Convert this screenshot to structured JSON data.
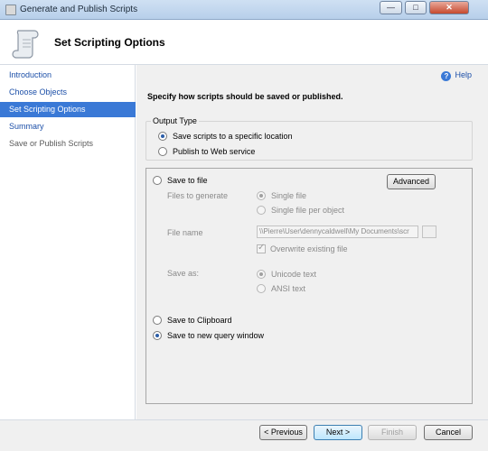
{
  "window": {
    "title": "Generate and Publish Scripts",
    "controls": {
      "minimize": "—",
      "maximize": "□",
      "close": "✕"
    }
  },
  "header": {
    "title": "Set Scripting Options"
  },
  "nav": {
    "items": [
      {
        "label": "Introduction",
        "state": "link"
      },
      {
        "label": "Choose Objects",
        "state": "link"
      },
      {
        "label": "Set Scripting Options",
        "state": "selected"
      },
      {
        "label": "Summary",
        "state": "link"
      },
      {
        "label": "Save or Publish Scripts",
        "state": "disabled"
      }
    ]
  },
  "main": {
    "help_label": "Help",
    "instruction": "Specify how scripts should be saved or published.",
    "output_type": {
      "title": "Output Type",
      "options": [
        {
          "label": "Save scripts to a specific location",
          "checked": true
        },
        {
          "label": "Publish to Web service",
          "checked": false
        }
      ]
    },
    "save_options": {
      "save_to_file": "Save to file",
      "advanced_button": "Advanced",
      "files_to_generate_label": "Files to generate",
      "single_file": "Single file",
      "single_file_per_object": "Single file per object",
      "file_name_label": "File name",
      "file_name_value": "\\\\Pierre\\User\\dennycaldwell\\My Documents\\scr",
      "overwrite_existing": "Overwrite existing file",
      "save_as_label": "Save as:",
      "unicode_text": "Unicode text",
      "ansi_text": "ANSI text",
      "save_to_clipboard": "Save to Clipboard",
      "save_to_query_window": "Save to new query window"
    }
  },
  "footer": {
    "previous": "< Previous",
    "next": "Next >",
    "finish": "Finish",
    "cancel": "Cancel"
  },
  "colors": {
    "accent": "#3a79d6",
    "link": "#1c4fa8"
  }
}
